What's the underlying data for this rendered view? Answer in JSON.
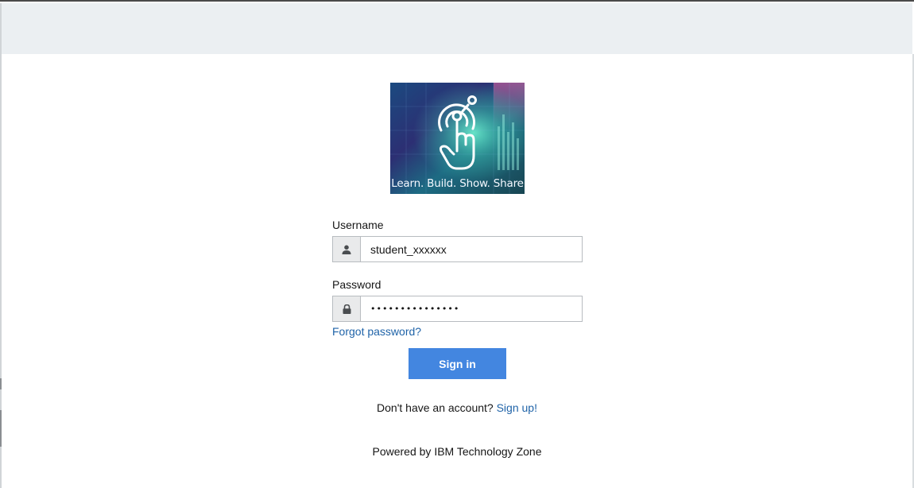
{
  "logo": {
    "tagline": "Learn. Build. Show. Share"
  },
  "form": {
    "username_label": "Username",
    "username_value": "student_xxxxxx",
    "password_label": "Password",
    "password_value": "•••••••••••••••",
    "forgot_link": "Forgot password?",
    "signin_label": "Sign in"
  },
  "signup": {
    "prompt": "Don't have an account?",
    "link": "Sign up!"
  },
  "footer": {
    "powered_by": "Powered by IBM Technology Zone"
  },
  "icons": {
    "username": "user-icon",
    "password": "lock-icon",
    "logo": "touch-hand-icon"
  },
  "colors": {
    "topbar": "#ebeff2",
    "link": "#1f63a8",
    "primary_button": "#4386e0"
  }
}
